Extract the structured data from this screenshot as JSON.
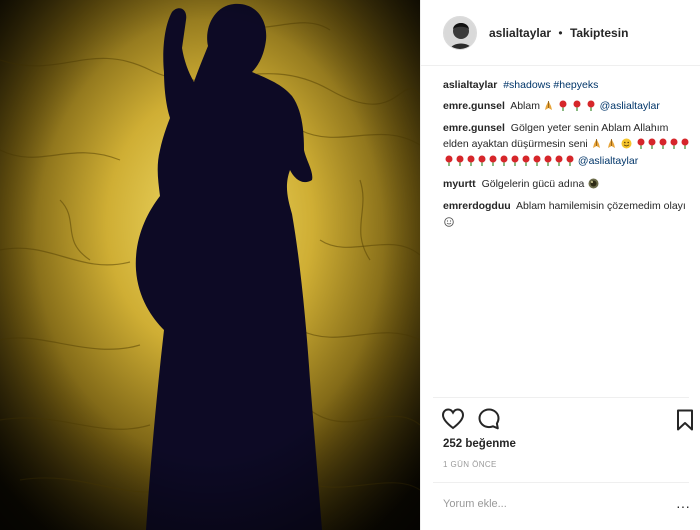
{
  "post": {
    "author": "aslialtaylar",
    "separator": "•",
    "follow_status": "Takiptesin"
  },
  "comments": [
    {
      "user": "aslialtaylar",
      "text": "",
      "tags": "#shadows #hepyeks"
    },
    {
      "user": "emre.gunsel",
      "text": "Ablam",
      "mention": "@aslialtaylar"
    },
    {
      "user": "emre.gunsel",
      "text": "Gölgen yeter senin Ablam Allahım elden ayaktan düşürmesin seni",
      "mention": "@aslialtaylar"
    },
    {
      "user": "myurtt",
      "text": "Gölgelerin gücü adına"
    },
    {
      "user": "emrerdogduu",
      "text": "Ablam hamilemisin çözemedim olayı"
    }
  ],
  "actions": {
    "like_icon": "heart-icon",
    "comment_icon": "speech-bubble-icon",
    "save_icon": "bookmark-icon"
  },
  "likes_text": "252 beğenme",
  "time_text": "1 GÜN ÖNCE",
  "comment_placeholder": "Yorum ekle...",
  "more_label": "···",
  "colors": {
    "link": "#003569",
    "muted": "#999999",
    "text": "#262626",
    "divider": "#efefef",
    "shadow": "#0d0a25",
    "ground": "#c9a82c"
  }
}
